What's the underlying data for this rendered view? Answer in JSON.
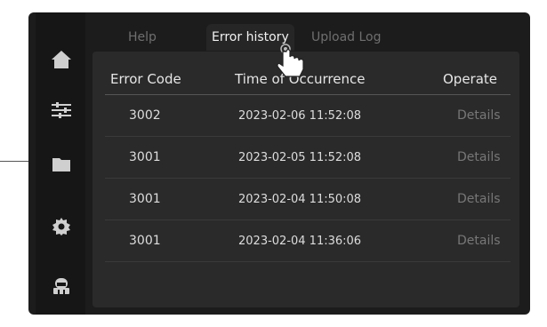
{
  "tabs": [
    {
      "label": "Help",
      "active": false
    },
    {
      "label": "Error history",
      "active": true
    },
    {
      "label": "Upload Log",
      "active": false
    }
  ],
  "sidebar": {
    "items": [
      {
        "icon": "home-icon"
      },
      {
        "icon": "sliders-icon"
      },
      {
        "icon": "folder-icon"
      },
      {
        "icon": "gear-icon"
      },
      {
        "icon": "robot-icon"
      }
    ]
  },
  "table": {
    "headers": {
      "code": "Error Code",
      "time": "Time of Occurrence",
      "operate": "Operate"
    },
    "rows": [
      {
        "code": "3002",
        "time": "2023-02-06  11:52:08",
        "action": "Details"
      },
      {
        "code": "3001",
        "time": "2023-02-05  11:52:08",
        "action": "Details"
      },
      {
        "code": "3001",
        "time": "2023-02-04  11:50:08",
        "action": "Details"
      },
      {
        "code": "3001",
        "time": "2023-02-04  11:36:06",
        "action": "Details"
      }
    ]
  },
  "colors": {
    "background": "#1c1c1c",
    "panel": "#2a2a2a",
    "active_tab_text": "#f2f2f2",
    "inactive_tab_text": "#6f6f6f",
    "details_text": "#777777"
  }
}
